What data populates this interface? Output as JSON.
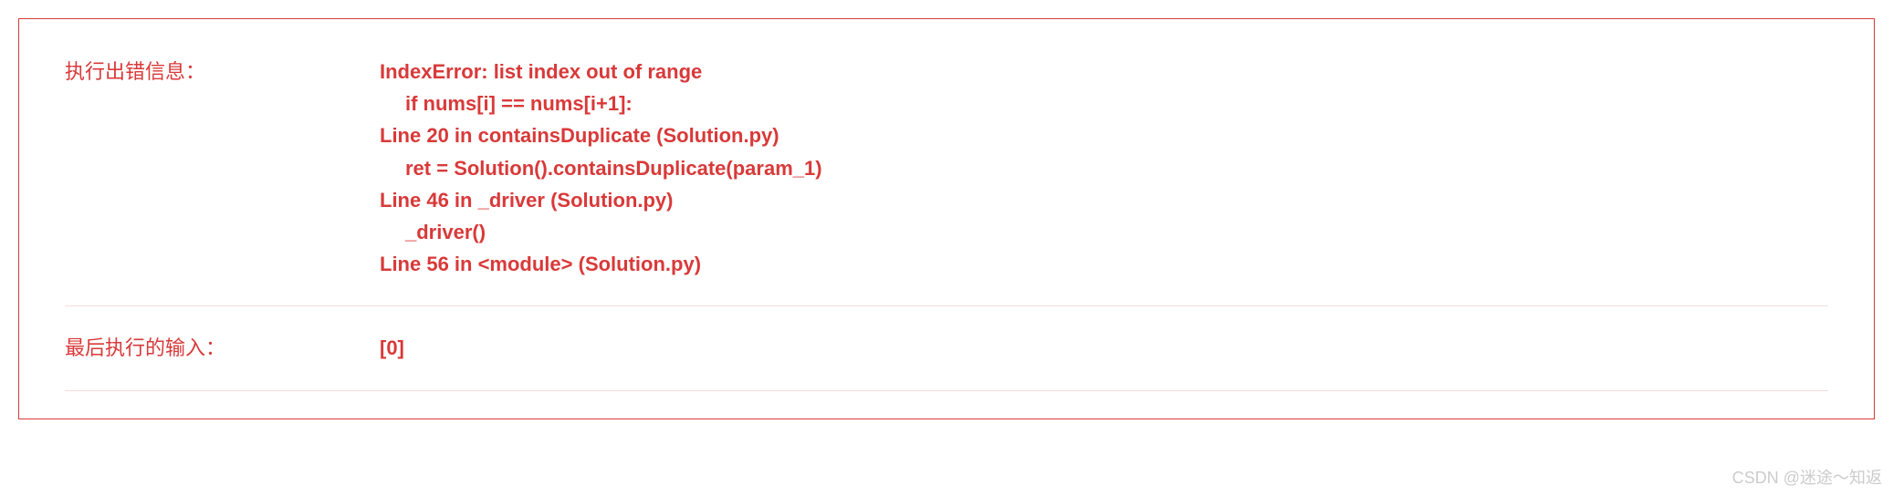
{
  "error": {
    "label": "执行出错信息：",
    "traceback": {
      "line1": "IndexError: list index out of range",
      "line2": "if nums[i] == nums[i+1]:",
      "line3": "Line 20 in containsDuplicate (Solution.py)",
      "line4": "ret = Solution().containsDuplicate(param_1)",
      "line5": "Line 46 in _driver (Solution.py)",
      "line6": "_driver()",
      "line7": "Line 56 in <module> (Solution.py)"
    }
  },
  "input": {
    "label": "最后执行的输入：",
    "value": "[0]"
  },
  "watermark": "CSDN @迷途～知返"
}
